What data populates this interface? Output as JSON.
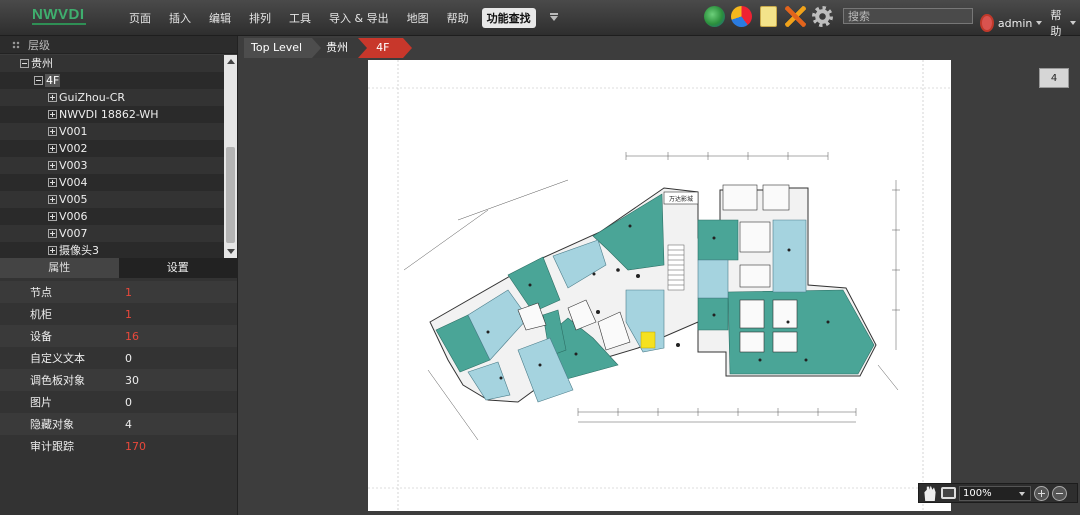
{
  "app": {
    "logo": "NWVDI"
  },
  "menu": [
    "页面",
    "插入",
    "编辑",
    "排列",
    "工具",
    "导入 & 导出",
    "地图",
    "帮助"
  ],
  "menu_active": "功能查找",
  "toolbar_icons": [
    "globe-icon",
    "pie-chart-icon",
    "note-icon",
    "tools-icon",
    "gear-icon"
  ],
  "search": {
    "placeholder": "搜索"
  },
  "user": {
    "name": "admin",
    "help": "帮助"
  },
  "tree": {
    "header": "层级",
    "root": "贵州",
    "floor": "4F",
    "items": [
      "GuiZhou-CR",
      "NWVDI 18862-WH",
      "V001",
      "V002",
      "V003",
      "V004",
      "V005",
      "V006",
      "V007",
      "摄像头3"
    ]
  },
  "properties": {
    "tabs": [
      "属性",
      "设置"
    ],
    "rows": [
      {
        "key": "节点",
        "value": "1",
        "highlight": true
      },
      {
        "key": "机柜",
        "value": "1",
        "highlight": true
      },
      {
        "key": "设备",
        "value": "16",
        "highlight": true
      },
      {
        "key": "自定义文本",
        "value": "0",
        "highlight": false
      },
      {
        "key": "调色板对象",
        "value": "30",
        "highlight": false
      },
      {
        "key": "图片",
        "value": "0",
        "highlight": false
      },
      {
        "key": "隐藏对象",
        "value": "4",
        "highlight": false
      },
      {
        "key": "审计跟踪",
        "value": "170",
        "highlight": true
      }
    ]
  },
  "breadcrumb": [
    "Top Level",
    "贵州",
    "4F"
  ],
  "plan": {
    "store_sign": "万达影城"
  },
  "page_number": "4",
  "zoom": {
    "level": "100%"
  },
  "colors": {
    "teal": "#4aa597",
    "light_blue": "#a5d3df",
    "highlight_yellow": "#f5e11f",
    "accent_red": "#c8372b",
    "logo_green": "#3fae6e"
  }
}
